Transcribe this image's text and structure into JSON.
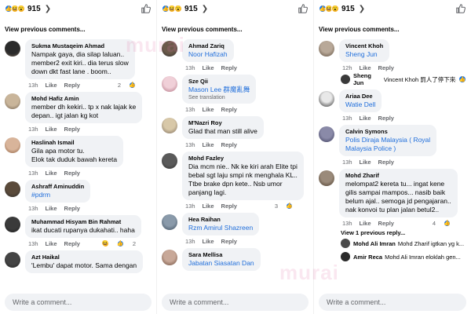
{
  "reactions_total": "915",
  "view_previous": "View previous comments...",
  "view_replies": "View 1 previous reply...",
  "action_like": "Like",
  "action_reply": "Reply",
  "write_placeholder": "Write a comment...",
  "see_translation": "See translation",
  "watermark": "murai",
  "colors": {
    "link": "#216fdb",
    "bubble": "#f0f2f5",
    "like": "#1877f2",
    "love": "#f33e58",
    "haha": "#f7b125"
  },
  "col1": [
    {
      "author": "Sukma Mustaqeim Ahmad",
      "text": "Nampak gaya, dia silap laluan..\nmember2 exit kiri.. dia terus slow\ndown dkt fast lane . boom..",
      "time": "13h",
      "count": "2"
    },
    {
      "author": "Mohd Hafiz Amin",
      "text": "member dh kekiri.. tp x nak lajak ke\ndepan.. igt jalan kg kot",
      "time": "13h",
      "count": ""
    },
    {
      "author": "Haslinah Ismail",
      "text": "Gila apa motor tu.\nElok tak duduk bawah kereta",
      "time": "13h",
      "count": ""
    },
    {
      "author": "Ashraff Aminuddin",
      "text": "#pdrm",
      "time": "13h",
      "count": ""
    },
    {
      "author": "Muhammad Hisyam Bin Rahmat",
      "text": "ikat ducati rupanya dukahati.. haha",
      "time": "13h",
      "count": "2"
    },
    {
      "author": "Azt Haikal",
      "text": "'Lembu' dapat motor. Sama dengan",
      "time": "",
      "count": ""
    }
  ],
  "col2": [
    {
      "author": "Ahmad Zariq",
      "text": "Noor Hafizah",
      "time": "13h",
      "count": ""
    },
    {
      "author": "Sze Qii",
      "text": "Mason Lee 群魔亂舞",
      "time": "13h",
      "count": ""
    },
    {
      "author": "M'Nazri Roy",
      "text": "Glad that man still alive",
      "time": "13h",
      "count": ""
    },
    {
      "author": "Mohd Fazley",
      "text": "Dia mcm nie.. Nk ke kiri arah Elite tpi\nbebal sgt laju smpi nk menghala KL..\nTtbe brake dpn kete.. Nsb umor\npanjang lagi.",
      "time": "13h",
      "count": "3"
    },
    {
      "author": "Hea Raihan",
      "text": "Rzm Amirul Shazreen",
      "time": "13h",
      "count": ""
    },
    {
      "author": "Sara Mellisa",
      "text": "Jabatan Siasatan Dan",
      "time": "",
      "count": ""
    }
  ],
  "col3": [
    {
      "author": "Vincent Khoh",
      "text": "Sheng Jun",
      "time": "12h",
      "count": ""
    },
    {
      "author": "Ariaa Dee",
      "text": "Watie Dell",
      "time": "13h",
      "count": ""
    },
    {
      "author": "Calvin Symons",
      "text": "Polis Diraja Malaysia ( Royal\nMalaysia Police )",
      "time": "13h",
      "count": ""
    },
    {
      "author": "Mohd Zharif",
      "text": "melompat2 kereta tu... ingat kene\ngilis sampai mampos... nasib baik\nbelum ajal.. semoga jd pengajaran..\nnak konvoi tu plan jalan betul2..",
      "time": "13h",
      "count": "4"
    }
  ],
  "col3_replies": [
    {
      "author": "Sheng Jun",
      "text": "Vincent Khoh 罰人了停下來看"
    },
    {
      "author": "Mohd Ali Imran",
      "text": "Mohd Zharif igtkan yg k..."
    },
    {
      "author": "Amir Reca",
      "text": "Mohd Ali Imran eloklah gen..."
    }
  ]
}
